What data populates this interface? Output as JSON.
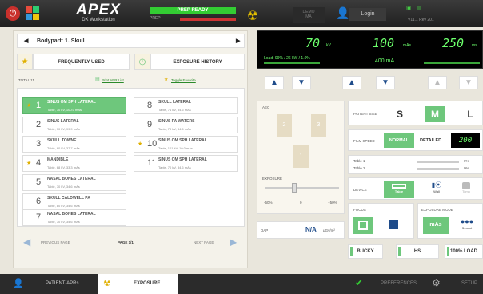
{
  "topbar": {
    "brand": "APEX",
    "brand_sub": "DX Workstation",
    "prep_status": "PREP READY",
    "prep_label": "PREP",
    "demo_line1": "DEMO",
    "demo_line2": "MA",
    "login_label": "Login",
    "version": "V11.1 Rev 201"
  },
  "bodypart": {
    "label": "Bodypart: 1. Skull"
  },
  "tabs": {
    "frequently_used": "FREQUENTLY USED",
    "exposure_history": "EXPOSURE HISTORY"
  },
  "list": {
    "total": "TOTAL 11",
    "print_link": "Print APR List",
    "favorite_link": "Toggle Favorite",
    "items": [
      {
        "num": "1",
        "name": "SINUS OM SPH LATERAL",
        "info": "Table, 70 kV, 100.0 mAs",
        "star": "★"
      },
      {
        "num": "2",
        "name": "SINUS LATERAL",
        "info": "Table, 70 kV, 99.9 mAs",
        "star": ""
      },
      {
        "num": "3",
        "name": "SKULL TOWNE",
        "info": "Table, 80 kV, 37.7 mAs",
        "star": ""
      },
      {
        "num": "4",
        "name": "MANDIBLE",
        "info": "Table, 68 kV, 33.3 mAs",
        "star": "★"
      },
      {
        "num": "5",
        "name": "NASAL BONES LATERAL",
        "info": "Table, 70 kV, 34.6 mAs",
        "star": ""
      },
      {
        "num": "6",
        "name": "SKULL CALDWELL PA",
        "info": "Table, 80 kV, 34.6 mAs",
        "star": ""
      },
      {
        "num": "7",
        "name": "NASAL BONES LATERAL",
        "info": "Table, 70 kV, 34.6 mAs",
        "star": ""
      },
      {
        "num": "8",
        "name": "SKULL LATERAL",
        "info": "Table, 71 kV, 34.6 mAs",
        "star": ""
      },
      {
        "num": "9",
        "name": "SINUS PA WATERS",
        "info": "Table, 70 kV, 34.6 mAs",
        "star": ""
      },
      {
        "num": "10",
        "name": "SINUS OM SPH LATERAL",
        "info": "Table, 101 kV, 10.0 mAs",
        "star": "★"
      },
      {
        "num": "11",
        "name": "SINUS OM SPH LATERAL",
        "info": "Table, 70 kV, 34.6 mAs",
        "star": ""
      }
    ],
    "prev_page": "PREVIOUS PAGE",
    "page": "PAGE 1/1",
    "next_page": "NEXT PAGE"
  },
  "display": {
    "kv": "70",
    "kv_unit": "kV",
    "mas": "100",
    "mas_unit": "mAs",
    "ms": "250",
    "ms_unit": "ms",
    "ma": "400 mA",
    "load": "Load: 99% / 26 kW / 1.0%"
  },
  "aec": {
    "title": "AEC",
    "chamber_left": "2",
    "chamber_right": "3",
    "chamber_center": "1",
    "exposure_label": "EXPOSURE",
    "scale": [
      "-50%",
      "0",
      "+50%"
    ]
  },
  "dap": {
    "label": "DAP",
    "value": "N/A",
    "unit": "μGy/m²"
  },
  "patient_size": {
    "label": "PATIENT SIZE",
    "options": [
      "S",
      "M",
      "L"
    ],
    "selected": "M"
  },
  "film_speed": {
    "label": "FILM SPEED",
    "normal": "NORMAL",
    "detailed": "DETAILED",
    "value": "200"
  },
  "tables": {
    "t1": "Table 1",
    "t2": "Table 2",
    "p1": "0%",
    "p2": "0%"
  },
  "device": {
    "label": "DEVICE",
    "table": "Table",
    "wall": "Wall",
    "tomo": "Tomo"
  },
  "focus": {
    "label": "FOCUS"
  },
  "exposure_mode": {
    "label": "EXPOSURE MODE",
    "mas": "mAs",
    "three_point": "3-point"
  },
  "bottom_buttons": {
    "bucky": "BUCKY",
    "hs": "HS",
    "load": "100% LOAD"
  },
  "footer": {
    "patient_tab": "PATIENT/APRs",
    "exposure_tab": "EXPOSURE",
    "preferences": "PREFERENCES",
    "setup": "SETUP"
  },
  "colors": {
    "accent_green": "#6ec77c",
    "led_green": "#6cff6c",
    "arrow_blue": "#1f4c8a"
  }
}
